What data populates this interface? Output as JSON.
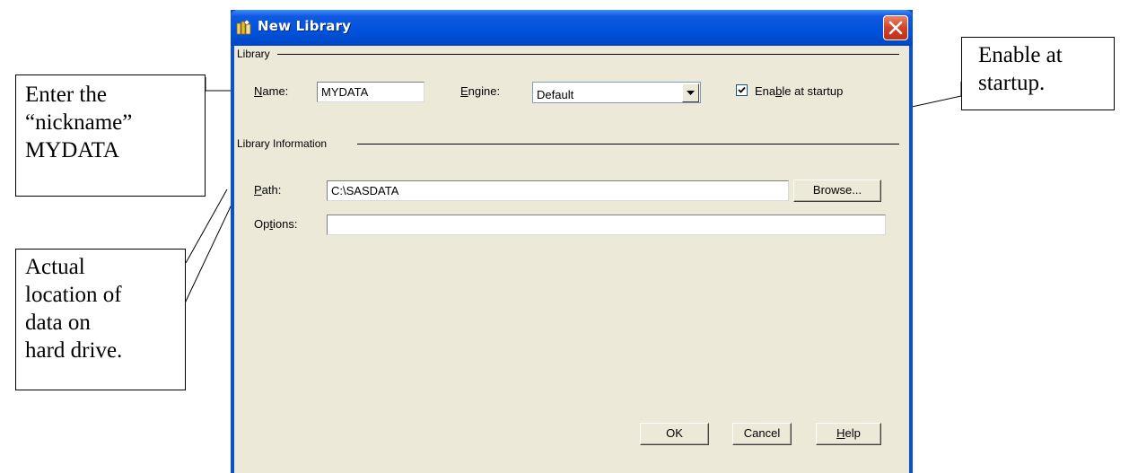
{
  "window": {
    "title": "New Library"
  },
  "library_group": {
    "label": "Library",
    "name_label": "Name:",
    "name_value": "MYDATA",
    "engine_label": "Engine:",
    "engine_value": "Default",
    "enable_checked": true,
    "enable_label": "Enable at startup"
  },
  "info_group": {
    "label": "Library Information",
    "path_label": "Path:",
    "path_value": "C:\\SASDATA",
    "browse_label": "Browse...",
    "options_label": "Options:",
    "options_value": ""
  },
  "buttons": {
    "ok": "OK",
    "cancel": "Cancel",
    "help": "Help"
  },
  "callouts": {
    "nickname": [
      "Enter the",
      "“nickname”",
      "MYDATA"
    ],
    "location": [
      "Actual",
      "location of",
      "data on",
      "hard drive."
    ],
    "startup": [
      "Enable at",
      "startup."
    ]
  }
}
